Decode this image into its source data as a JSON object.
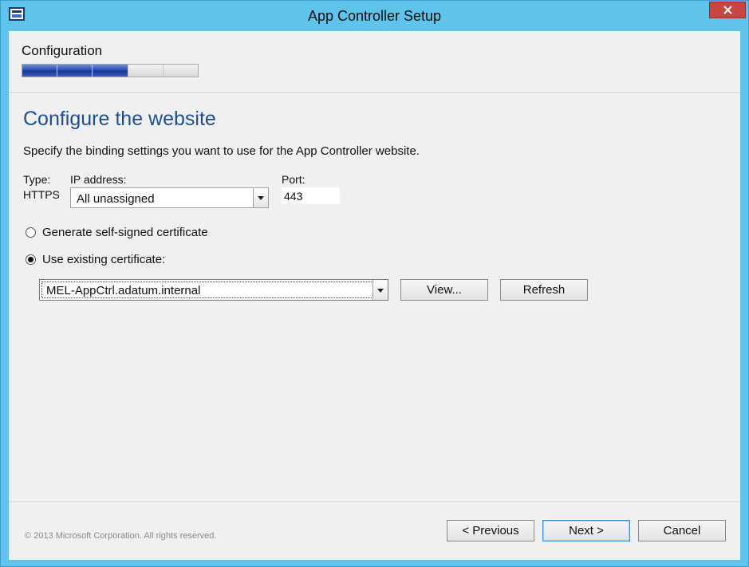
{
  "window": {
    "title": "App Controller Setup",
    "accent_color": "#5fc4ec",
    "icon": "app-window-icon",
    "close_icon": "close-x-icon",
    "close_color": "#c7463d"
  },
  "wizard": {
    "stage": "Configuration",
    "progress": {
      "completed_steps": 3,
      "total_steps": 5
    }
  },
  "page": {
    "heading": "Configure the website",
    "instructions": "Specify the binding settings you want to use for the App Controller website."
  },
  "binding": {
    "type_label": "Type:",
    "type_value": "HTTPS",
    "ip_label": "IP address:",
    "ip_value": "All unassigned",
    "port_label": "Port:",
    "port_value": "443"
  },
  "certificate": {
    "option_generate": "Generate self-signed certificate",
    "option_existing": "Use existing certificate:",
    "selected_option": "existing",
    "selected_cert": "MEL-AppCtrl.adatum.internal",
    "view_label": "View...",
    "refresh_label": "Refresh"
  },
  "footer": {
    "copyright": "© 2013 Microsoft Corporation. All rights reserved.",
    "previous_label": "< Previous",
    "next_label": "Next >",
    "cancel_label": "Cancel"
  }
}
